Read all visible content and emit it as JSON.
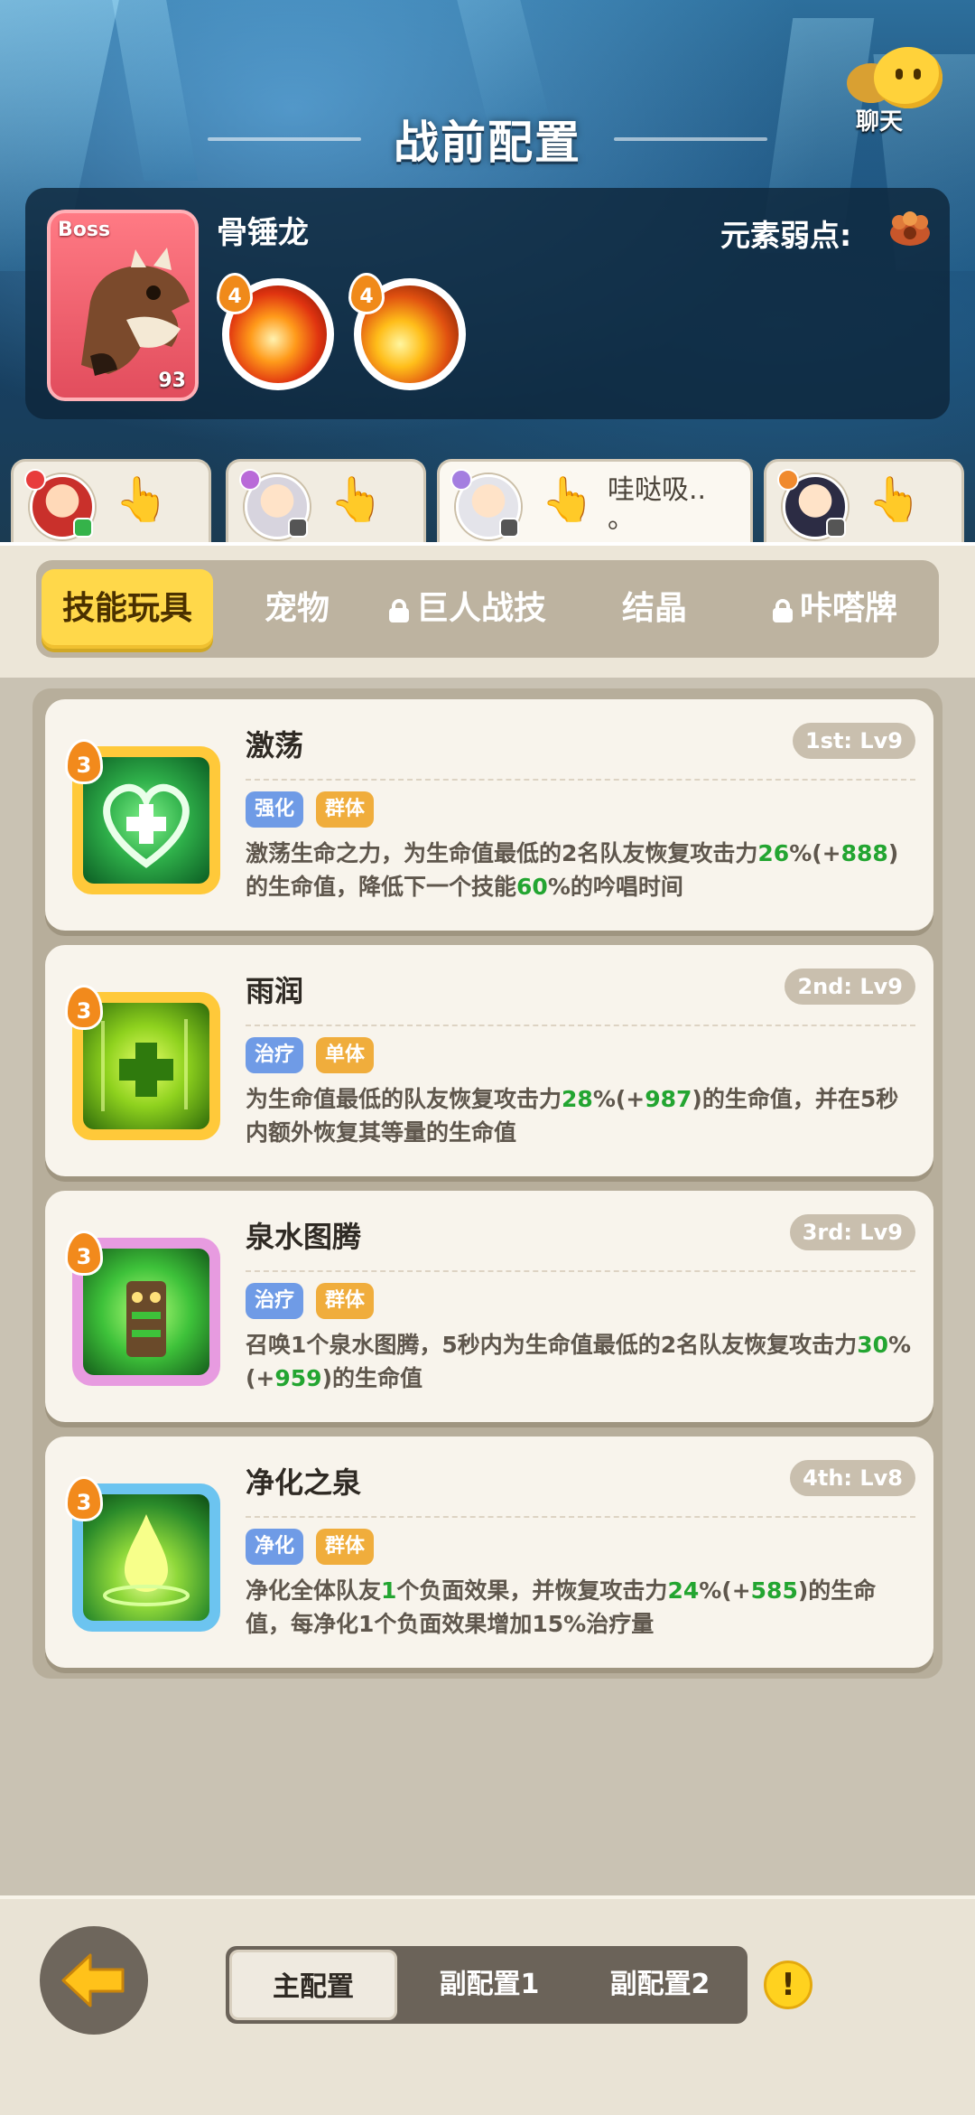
{
  "header": {
    "title": "战前配置",
    "chat_label": "聊天"
  },
  "boss": {
    "tag": "Boss",
    "level": "93",
    "name": "骨锤龙",
    "weakness_label": "元素弱点:",
    "skills": [
      {
        "level": "4",
        "icon": "fire-phoenix-icon"
      },
      {
        "level": "4",
        "icon": "fire-slash-icon"
      }
    ]
  },
  "heroes": [
    {
      "name": "hero-red-hair",
      "status_color": "#35b34a"
    },
    {
      "name": "hero-silver-hair",
      "status_color": "#555"
    },
    {
      "name": "hero-white-hair",
      "status_color": "#555",
      "chat": "哇哒吸..",
      "chat2": "。"
    },
    {
      "name": "hero-dark-hair",
      "status_color": "#555"
    }
  ],
  "categories": [
    {
      "label": "技能玩具",
      "locked": false
    },
    {
      "label": "宠物",
      "locked": false
    },
    {
      "label": "巨人战技",
      "locked": true
    },
    {
      "label": "结晶",
      "locked": false
    },
    {
      "label": "咔嗒牌",
      "locked": true
    }
  ],
  "skills": [
    {
      "title": "激荡",
      "rank": "1st: Lv9",
      "level_badge": "3",
      "tag1": "强化",
      "tag2": "群体",
      "desc": {
        "a": "激荡生命之力，为生命值最低的2名队友恢复攻击力",
        "g1": "26",
        "b": "%(+",
        "g2": "888",
        "c": ")的生命值，降低下一个技能",
        "g3": "60",
        "d": "%的吟唱时间"
      }
    },
    {
      "title": "雨润",
      "rank": "2nd: Lv9",
      "level_badge": "3",
      "tag1": "治疗",
      "tag2": "单体",
      "desc": {
        "a": "为生命值最低的队友恢复攻击力",
        "g1": "28",
        "b": "%(+",
        "g2": "987",
        "c": ")的生命值，并在5秒内额外恢复其等量的生命值"
      }
    },
    {
      "title": "泉水图腾",
      "rank": "3rd: Lv9",
      "level_badge": "3",
      "tag1": "治疗",
      "tag2": "群体",
      "desc": {
        "a": "召唤1个泉水图腾，5秒内为生命值最低的2名队友恢复攻击力",
        "g1": "30",
        "b": "%(+",
        "g2": "959",
        "c": ")的生命值"
      }
    },
    {
      "title": "净化之泉",
      "rank": "4th: Lv8",
      "level_badge": "3",
      "tag1": "净化",
      "tag2": "群体",
      "desc": {
        "a": "净化全体队友",
        "g0": "1",
        "a2": "个负面效果，并恢复攻击力",
        "g1": "24",
        "b": "%(+",
        "g2": "585",
        "c": ")的生命值，每净化1个负面效果增加15%治疗量"
      }
    }
  ],
  "bottom": {
    "configs": [
      "主配置",
      "副配置1",
      "副配置2"
    ],
    "info": "!"
  },
  "colors": {
    "accent_yellow": "#ffd84a",
    "value_green": "#23a531",
    "tag_blue": "#6f9be6",
    "tag_orange": "#f0ad3c"
  }
}
